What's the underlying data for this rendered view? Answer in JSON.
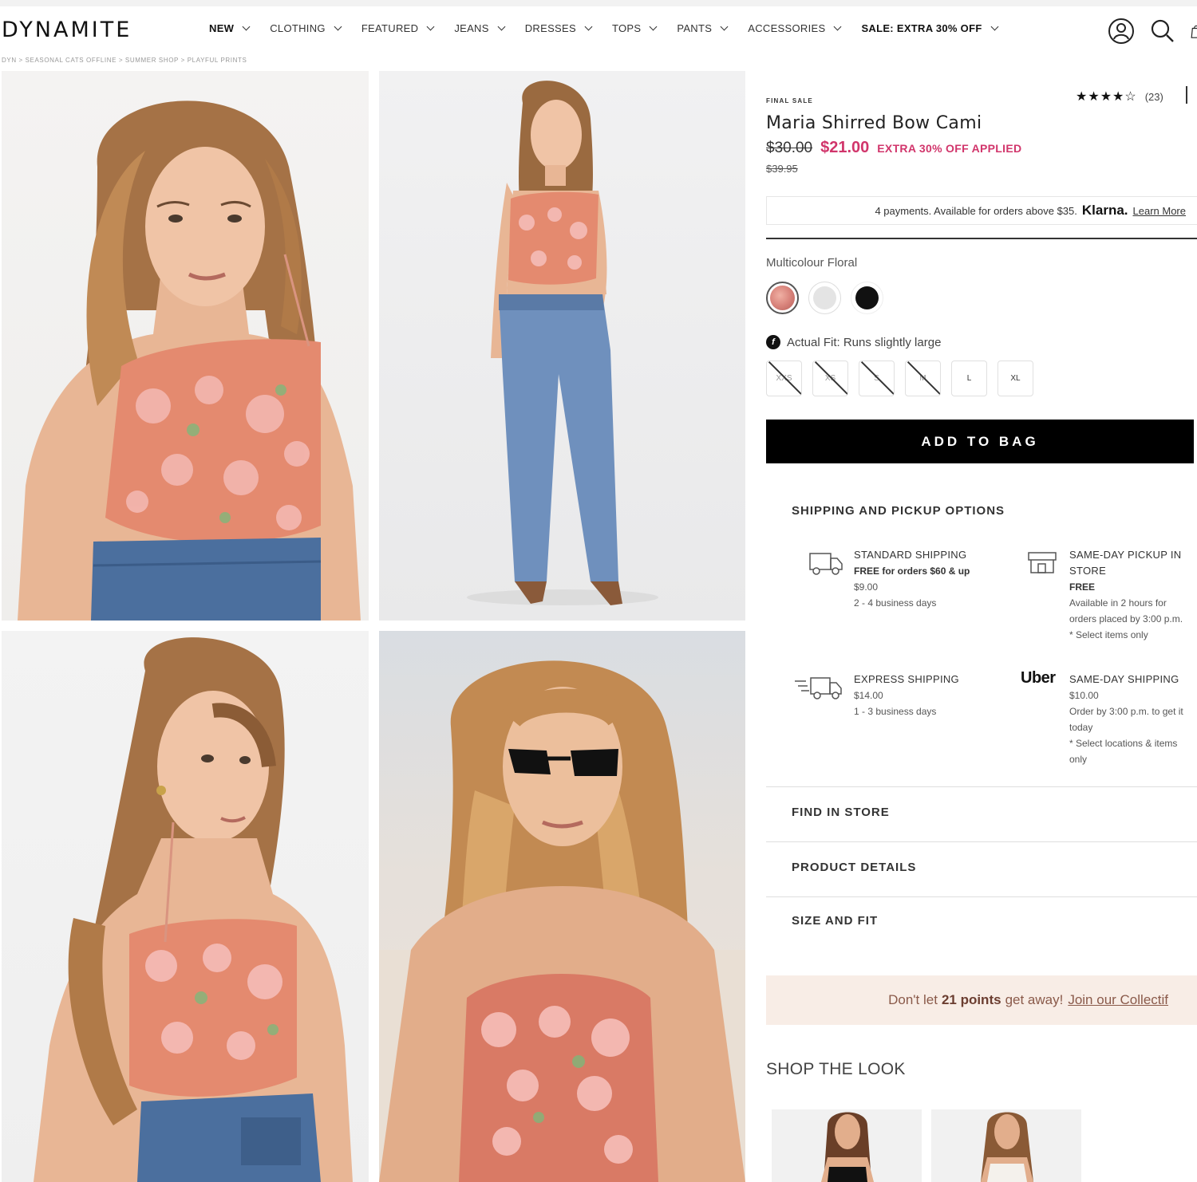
{
  "header": {
    "logo": "DYNAMITE",
    "nav": [
      {
        "label": "NEW"
      },
      {
        "label": "CLOTHING"
      },
      {
        "label": "FEATURED"
      },
      {
        "label": "JEANS"
      },
      {
        "label": "DRESSES"
      },
      {
        "label": "TOPS"
      },
      {
        "label": "PANTS"
      },
      {
        "label": "ACCESSORIES"
      },
      {
        "label": "SALE: EXTRA 30% OFF"
      }
    ],
    "icons": [
      "account-icon",
      "search-icon",
      "bag-icon"
    ]
  },
  "breadcrumb": "DYN > SEASONAL CATS OFFLINE > SUMMER SHOP > PLAYFUL PRINTS",
  "product": {
    "badge": "FINAL SALE",
    "rating_stars": "★★★★☆",
    "rating_count": "(23)",
    "title": "Maria Shirred Bow Cami",
    "old_price": "$30.00",
    "new_price": "$21.00",
    "extra_label": "EXTRA 30% OFF APPLIED",
    "original_price": "$39.95",
    "klarna": {
      "text": "4 payments. Available for orders above $35.",
      "brand": "Klarna.",
      "link": "Learn More"
    },
    "colour_label": "Multicolour Floral",
    "swatches": [
      {
        "name": "Multicolour Floral",
        "color": "#d9847c",
        "selected": true
      },
      {
        "name": "White",
        "color": "#e4e4e4",
        "selected": false
      },
      {
        "name": "Black",
        "color": "#111111",
        "selected": false
      }
    ],
    "fit_text": "Actual Fit: Runs slightly large",
    "sizes": [
      {
        "label": "XXS",
        "available": false
      },
      {
        "label": "XS",
        "available": false
      },
      {
        "label": "S",
        "available": false
      },
      {
        "label": "M",
        "available": false
      },
      {
        "label": "L",
        "available": true
      },
      {
        "label": "XL",
        "available": true
      }
    ],
    "add_to_bag": "ADD TO BAG"
  },
  "shipping": {
    "heading": "SHIPPING AND PICKUP OPTIONS",
    "standard": {
      "title": "STANDARD SHIPPING",
      "line1": "FREE for orders $60 & up",
      "line2": "$9.00",
      "line3": "2 - 4 business days"
    },
    "pickup": {
      "title_1": "SAME-DAY PICKUP IN",
      "title_2": "STORE",
      "line1": "FREE",
      "line2": "Available in 2 hours for",
      "line3": "orders placed by 3:00 p.m.",
      "line4": "* Select items only"
    },
    "express": {
      "title": "EXPRESS SHIPPING",
      "line1": "$14.00",
      "line2": "1 - 3 business days"
    },
    "uber_logo": "Uber",
    "sameday": {
      "title": "SAME-DAY SHIPPING",
      "line1": "$10.00",
      "line2": "Order by 3:00 p.m. to get it",
      "line3": "today",
      "line4": "* Select locations & items",
      "line5": "only"
    }
  },
  "accordions": {
    "find_in_store": "FIND IN STORE",
    "product_details": "PRODUCT DETAILS",
    "size_and_fit": "SIZE AND FIT"
  },
  "points_banner": {
    "prefix": "Don't let",
    "points": "21 points",
    "suffix": "get away!",
    "link": "Join our Collectif"
  },
  "shop_the_look": "SHOP THE LOOK"
}
